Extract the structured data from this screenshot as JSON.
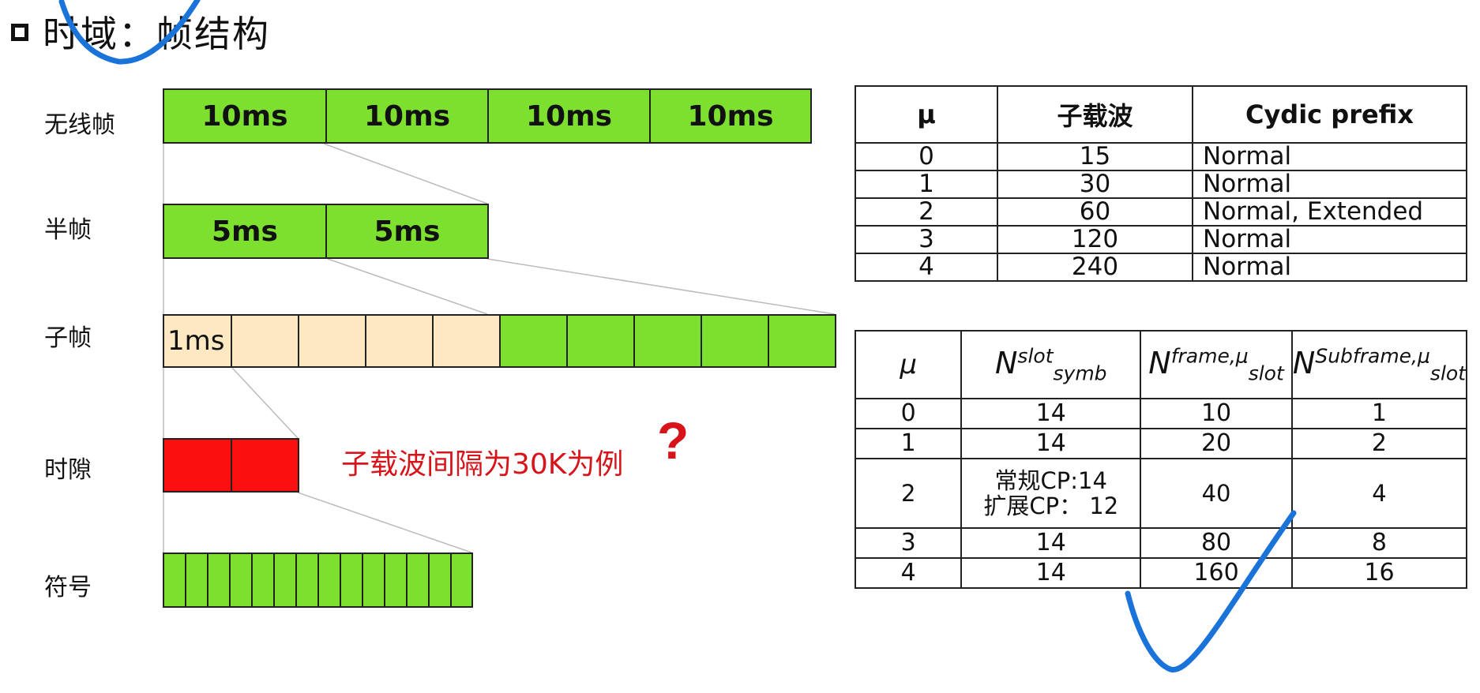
{
  "title": "时域：帧结构",
  "rows": {
    "radio_frame": {
      "label": "无线帧",
      "cells": [
        "10ms",
        "10ms",
        "10ms",
        "10ms"
      ]
    },
    "half_frame": {
      "label": "半帧",
      "cells": [
        "5ms",
        "5ms"
      ]
    },
    "subframe": {
      "label": "子帧",
      "first_cell": "1ms",
      "cell_count": 10
    },
    "slot": {
      "label": "时隙",
      "cell_count": 2
    },
    "symbol": {
      "label": "符号",
      "cell_count": 14
    }
  },
  "note": "子载波间隔为30K为例",
  "question_mark": "?",
  "table_top": {
    "headers": [
      "μ",
      "子载波",
      "Cydic prefix"
    ],
    "rows": [
      [
        "0",
        "15",
        "Normal"
      ],
      [
        "1",
        "30",
        "Normal"
      ],
      [
        "2",
        "60",
        "Normal, Extended"
      ],
      [
        "3",
        "120",
        "Normal"
      ],
      [
        "4",
        "240",
        "Normal"
      ]
    ]
  },
  "table_bottom": {
    "headers": {
      "mu": "μ",
      "col1": {
        "base": "N",
        "sup": "slot",
        "sub": "symb"
      },
      "col2": {
        "base": "N",
        "sup": "frame,μ",
        "sub": "slot"
      },
      "col3": {
        "base": "N",
        "sup": "Subframe,μ",
        "sub": "slot"
      }
    },
    "rows": [
      [
        "0",
        "14",
        "10",
        "1"
      ],
      [
        "1",
        "14",
        "20",
        "2"
      ],
      [
        "2",
        "常规CP:14",
        "40",
        "4"
      ],
      [
        "3",
        "14",
        "80",
        "8"
      ],
      [
        "4",
        "14",
        "160",
        "16"
      ]
    ],
    "row2_line2": "扩展CP：  12"
  },
  "colors": {
    "green": "#7ee02e",
    "cream": "#fde8c2",
    "red": "#fb0f0f",
    "annotation_red": "#d7141a",
    "pen_blue": "#1a73d9"
  }
}
